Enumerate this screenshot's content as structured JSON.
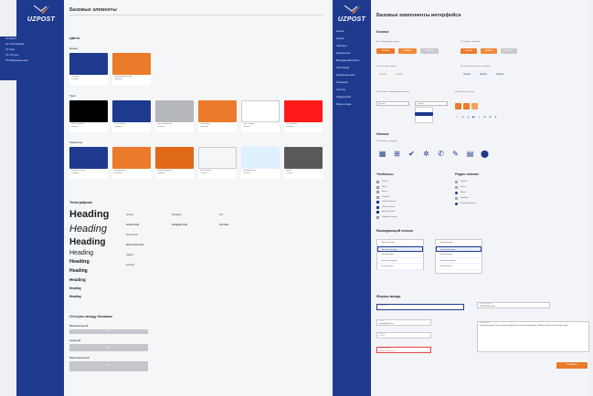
{
  "brand": {
    "name": "UZPOST",
    "blue": "#1e3a8f",
    "orange": "#ea7b2a"
  },
  "left_panel": {
    "menu": [
      "UX Цвета",
      "UX Типографика",
      "UX Тени",
      "UX Отступы",
      "UX Модальные окна"
    ],
    "title": "Базовые элементы",
    "colors_heading": "Цвета",
    "brand_heading": "Бренд",
    "brand_swatches": [
      {
        "color": "#1e3a8f",
        "name": "Основной",
        "hex": "#1E3A8F"
      },
      {
        "color": "#ea7b2a",
        "name": "Дополнительный цвет",
        "hex": "#EA7B2A"
      }
    ],
    "text_heading": "Текст",
    "text_swatches": [
      {
        "color": "#000000",
        "name": "Текст основной",
        "hex": "#000000"
      },
      {
        "color": "#1e3a8f",
        "name": "Текст ссылки",
        "hex": "#1E3A8F"
      },
      {
        "color": "#b5b7bb",
        "name": "Текст неактивный",
        "hex": "#B5B7BB"
      },
      {
        "color": "#ea7b2a",
        "name": "Текст акцент",
        "hex": "#EA7B2A"
      },
      {
        "color": "#ffffff",
        "name": "Текст на фоне",
        "hex": "#FFFFFF"
      },
      {
        "color": "#ff1a1a",
        "name": "Текст ошибки",
        "hex": "#FF1A1A"
      }
    ],
    "elements_heading": "Элементы",
    "element_swatches": [
      {
        "color": "#1e3a8f",
        "name": "Кнопки основные",
        "hex": "#1E3A8F"
      },
      {
        "color": "#ea7b2a",
        "name": "Кнопки акцент",
        "hex": "#EA7B2A"
      },
      {
        "color": "#e06a1a",
        "name": "Кнопки наведение",
        "hex": "#E06A1A"
      },
      {
        "color": "#f5f6f8",
        "name": "Фон основной",
        "hex": "#F5F6F8"
      },
      {
        "color": "#dff0ff",
        "name": "Фон выделения",
        "hex": "#DFF0FF"
      },
      {
        "color": "#595959",
        "name": "Иконки",
        "hex": "#595959"
      }
    ],
    "typo_heading": "Типографика",
    "headings": [
      "Heading",
      "Heading",
      "Heading",
      "Heading",
      "Heading",
      "Heading",
      "Heading",
      "Heading",
      "Heading",
      "Heading"
    ],
    "typo_cols": [
      [
        "Content",
        "Content bold",
        "Sub Content",
        "Sub Content bold",
        "Caption",
        "Footnote"
      ],
      [
        "Paragraph",
        "Paragraph bold",
        "",
        "",
        "",
        ""
      ],
      [
        "Text",
        "Text bold",
        "",
        "",
        "",
        ""
      ]
    ],
    "spacing_heading": "Отступы между блоками",
    "spacing": [
      {
        "label": "Минимальный",
        "value": "8px"
      },
      {
        "label": "Средний",
        "value": "16px"
      },
      {
        "label": "Максимальный",
        "value": "24px"
      }
    ]
  },
  "right_panel": {
    "menu": [
      "Кнопки",
      "Иконки",
      "Чекбоксы",
      "Радиокнопки",
      "Выпадающий список",
      "Поля ввода",
      "Модальные окна",
      "Пагинация",
      "Тултипы",
      "Уведомления",
      "Формы входа"
    ],
    "title": "Базовые компоненты интерфейса",
    "buttons_heading": "Кнопки",
    "b1": "01. Стандартные кнопки",
    "b2": "02. Кнопки с иконкой",
    "b3": "03. Текстовые кнопки",
    "b4": "04. Текстовые кнопки с иконкой",
    "b5": "05. Кнопки с выпадающим списком",
    "b6": "06. Кнопки соцсетей",
    "btn_label": "Кнопка",
    "icons_heading": "Иконки",
    "icons_sub": "01. Иконки с заливкой",
    "checkbox_heading": "Чекбоксы",
    "checkbox_items": [
      "Default",
      "Hover",
      "Active",
      "Disabled",
      "Default checked",
      "Hover checked",
      "Active checked",
      "Disabled checked"
    ],
    "radio_heading": "Радио кнопки",
    "radio_items": [
      "Default",
      "Hover",
      "Active",
      "Disabled",
      "Disabled checked"
    ],
    "dropdown_heading": "Выпадающий список",
    "list_left": [
      "Первый раздел",
      "Активный раздел",
      "Третий раздел",
      "Четвертый раздел",
      "Пятый раздел"
    ],
    "list_right": [
      "Первый раздел",
      "Активный раздел",
      "Третий раздел",
      "Четвертый раздел",
      "Пятый раздел"
    ],
    "forms_heading": "Формы ввода",
    "fields": [
      {
        "label": "Введите текст",
        "value": ""
      },
      {
        "label": "Номер телефона",
        "value": "+998 90 000 00 00"
      },
      {
        "label": "Почта",
        "value": "example@mail.ru"
      },
      {
        "label": "Ошибка ввода",
        "value": "Введите корректно"
      },
      {
        "label": "Пароль",
        "value": "********"
      }
    ],
    "textarea_label": "Комментарий",
    "textarea_text": "Lorem ipsum dolor sit amet consectetur adipiscing elit sed do eiusmod tempor incididunt ut labore et dolore magna aliqua",
    "submit": "Отправить"
  }
}
